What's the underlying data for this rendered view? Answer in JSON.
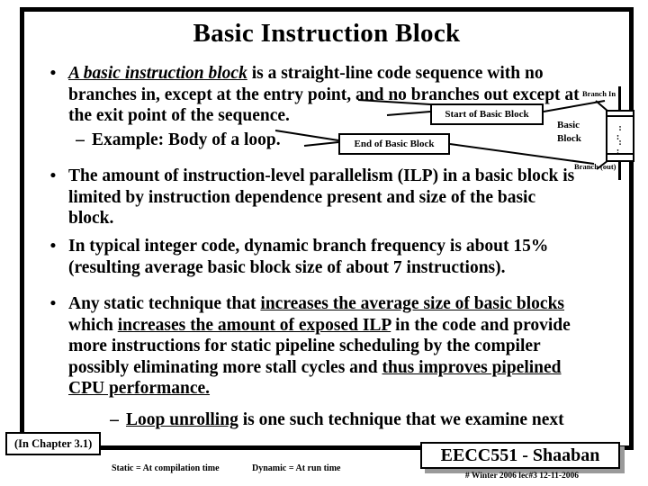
{
  "slide": {
    "title": "Basic Instruction Block",
    "bullets": [
      {
        "marker": "•",
        "lead_emphasis": "A basic instruction block",
        "rest": " is a straight-line code sequence with no branches in, except at the entry point,  and no branches out except at the exit point of the sequence.",
        "sub": {
          "marker": "–",
          "text": "Example:  Body of a loop."
        }
      },
      {
        "marker": "•",
        "text": "The amount of instruction-level parallelism (ILP) in a basic block is limited by instruction dependence present and size of the basic block."
      },
      {
        "marker": "•",
        "text": "In typical integer code, dynamic branch frequency is about 15% (resulting average basic block size of about 7 instructions)."
      },
      {
        "marker": "•",
        "segments": [
          {
            "text": "Any static technique that ",
            "underline": false
          },
          {
            "text": "increases the average size of basic blocks",
            "underline": true
          },
          {
            "text": "  which ",
            "underline": false
          },
          {
            "text": "increases the amount of exposed ILP",
            "underline": true
          },
          {
            "text": " in the code and provide more instructions for static pipeline scheduling by the compiler possibly eliminating more stall cycles and ",
            "underline": false
          },
          {
            "text": "thus improves pipelined CPU performance.",
            "underline": true
          }
        ],
        "sub": {
          "marker": "–",
          "emphasis": "Loop unrolling",
          "rest": " is one such technique that we examine next"
        }
      }
    ]
  },
  "callouts": {
    "start_of_block": "Start of Basic Block",
    "end_of_block": "End of Basic Block"
  },
  "diagram": {
    "branch_in": "Branch In",
    "branch_out": "Branch (out)",
    "block_label_line1": "Basic",
    "block_label_line2": "Block",
    "dots_row1": ": :",
    "dots_row2": ": :"
  },
  "footer": {
    "chapter": "(In  Chapter 3.1)",
    "static_note": "Static = At compilation time",
    "dynamic_note": "Dynamic  =  At run time",
    "brand": "EECC551 - Shaaban",
    "date_line": "# Winter 2006  lec#3   12-11-2006"
  },
  "colors": {
    "ink": "#000000",
    "background": "#ffffff",
    "shadow": "#9a9a9a"
  }
}
